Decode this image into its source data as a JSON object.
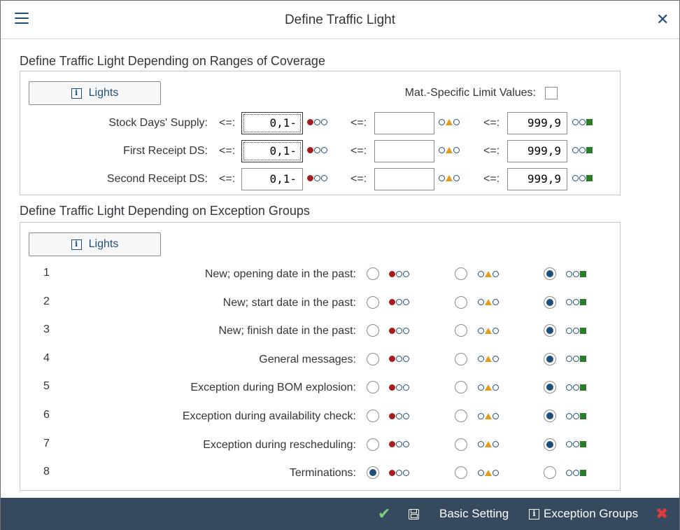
{
  "window": {
    "title": "Define Traffic Light"
  },
  "coverage": {
    "section_title": "Define Traffic Light Depending on Ranges of Coverage",
    "lights_label": "Lights",
    "mat_specific_label": "Mat.-Specific Limit Values:",
    "mat_specific_checked": false,
    "operator": "<=:",
    "rows": [
      {
        "label": "Stock Days' Supply:",
        "red_value": "0,1-",
        "yellow_value": "",
        "green_value": "999,9"
      },
      {
        "label": "First Receipt DS:",
        "red_value": "0,1-",
        "yellow_value": "",
        "green_value": "999,9"
      },
      {
        "label": "Second Receipt DS:",
        "red_value": "0,1-",
        "yellow_value": "",
        "green_value": "999,9"
      }
    ]
  },
  "exceptions": {
    "section_title": "Define Traffic Light Depending on Exception Groups",
    "lights_label": "Lights",
    "rows": [
      {
        "num": "1",
        "label": "New; opening date in the past:",
        "selected": "green"
      },
      {
        "num": "2",
        "label": "New; start date in the past:",
        "selected": "green"
      },
      {
        "num": "3",
        "label": "New; finish date in the past:",
        "selected": "green"
      },
      {
        "num": "4",
        "label": "General messages:",
        "selected": "green"
      },
      {
        "num": "5",
        "label": "Exception during BOM explosion:",
        "selected": "green"
      },
      {
        "num": "6",
        "label": "Exception during availability check:",
        "selected": "green"
      },
      {
        "num": "7",
        "label": "Exception during rescheduling:",
        "selected": "green"
      },
      {
        "num": "8",
        "label": "Terminations:",
        "selected": "red"
      }
    ]
  },
  "footer": {
    "basic_setting_label": "Basic Setting",
    "exception_groups_label": "Exception Groups"
  },
  "icons": {
    "menu": "hamburger-menu-icon",
    "close": "close-icon",
    "info": "info-icon",
    "confirm": "checkmark-icon",
    "save": "save-icon",
    "cancel": "cancel-icon",
    "red_light": "red-traffic-light-icon",
    "yellow_light": "yellow-traffic-light-icon",
    "green_light": "green-traffic-light-icon"
  },
  "colors": {
    "accent": "#1d4f7a",
    "footer_bg": "#354a5f",
    "red": "#a51d1d",
    "yellow": "#e09d1e",
    "green": "#2b7d2b",
    "confirm_green": "#7ad27a",
    "cancel_red": "#e03a3a"
  }
}
